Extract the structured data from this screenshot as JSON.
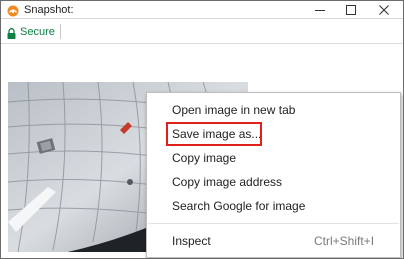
{
  "window": {
    "title": "Snapshot:",
    "app_icon": "camera-app-icon",
    "controls": {
      "minimize_icon": "minimize-icon",
      "maximize_icon": "maximize-icon",
      "close_icon": "close-icon"
    }
  },
  "address_bar": {
    "lock_icon": "lock-icon",
    "security_label": "Secure",
    "security_color": "#0b8043"
  },
  "page": {
    "image_description_name": "ceiling-snapshot-image"
  },
  "context_menu": {
    "items": [
      {
        "label": "Open image in new tab",
        "shortcut": ""
      },
      {
        "label": "Save image as...",
        "shortcut": "",
        "highlighted": true
      },
      {
        "label": "Copy image",
        "shortcut": ""
      },
      {
        "label": "Copy image address",
        "shortcut": ""
      },
      {
        "label": "Search Google for image",
        "shortcut": ""
      },
      {
        "label": "Inspect",
        "shortcut": "Ctrl+Shift+I"
      }
    ],
    "highlight_color": "#e0201b"
  }
}
